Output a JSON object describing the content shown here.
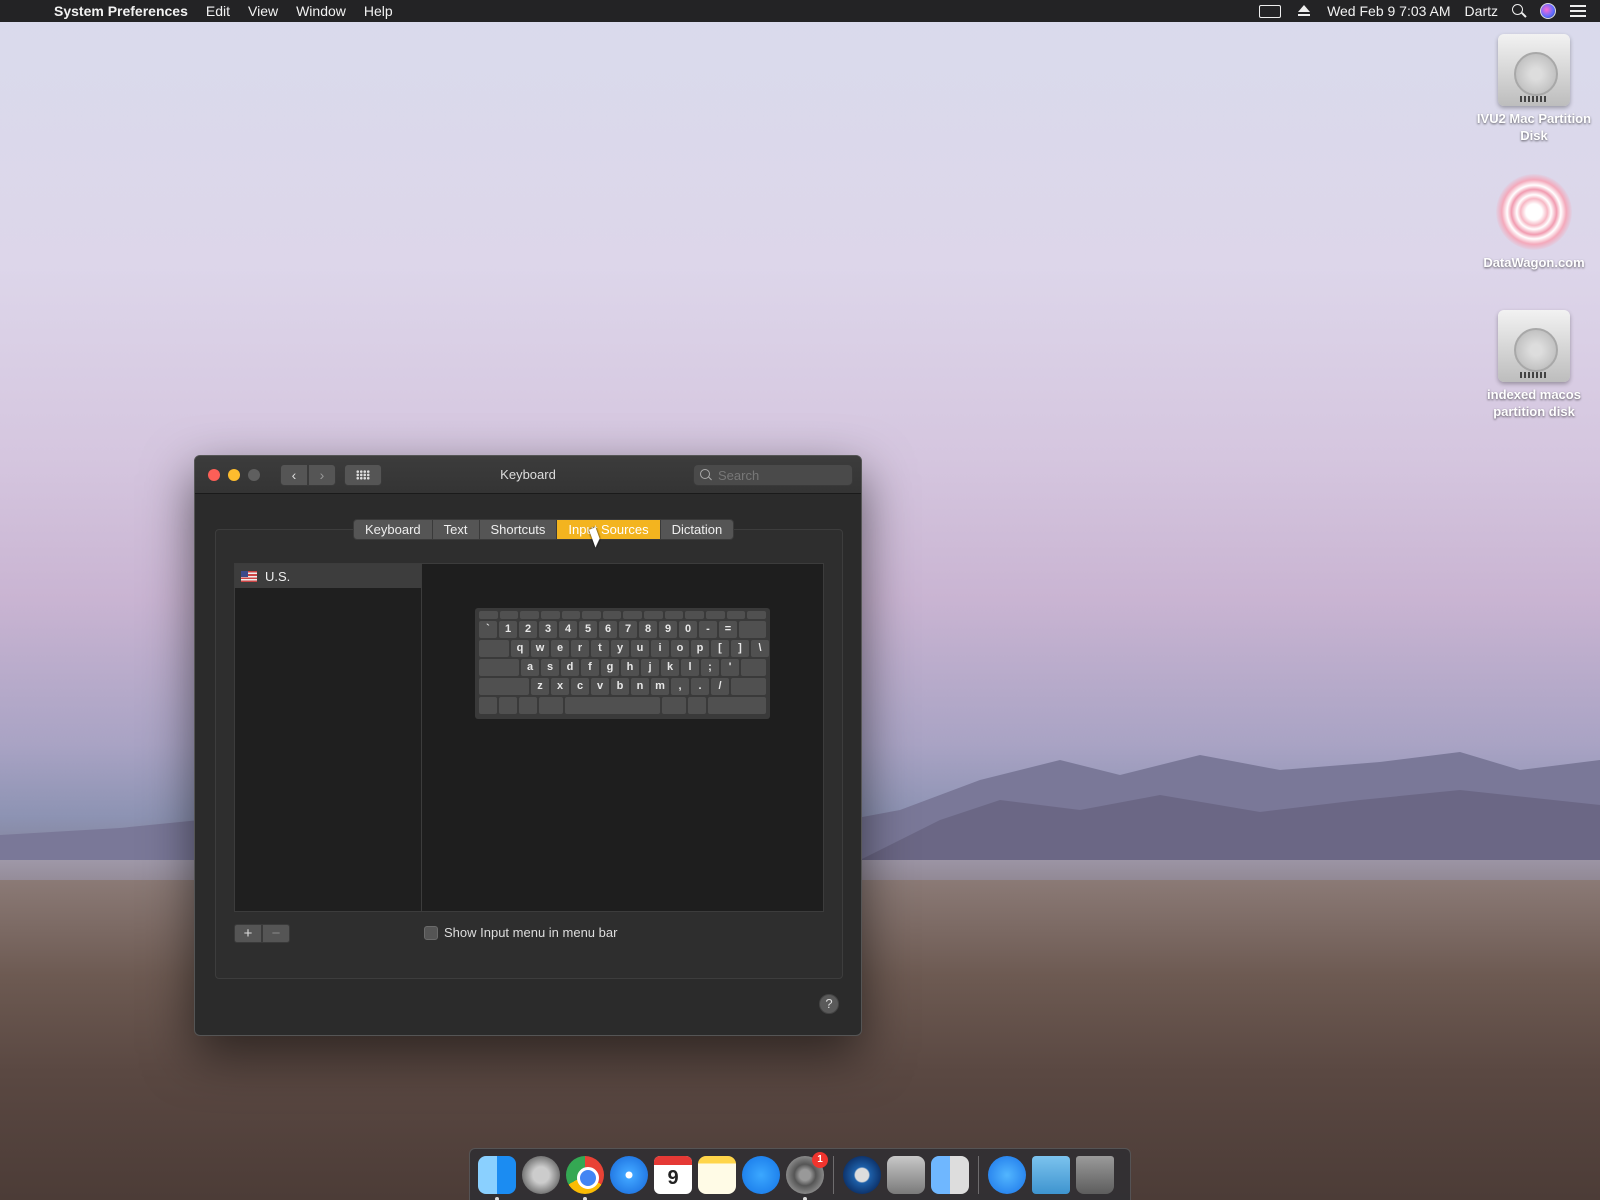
{
  "menubar": {
    "app_name": "System Preferences",
    "menus": [
      "Edit",
      "View",
      "Window",
      "Help"
    ],
    "clock": "Wed Feb 9  7:03 AM",
    "user": "Dartz"
  },
  "desktop_icons": [
    {
      "label": "IVU2 Mac Partition Disk"
    },
    {
      "label": "DataWagon.com"
    },
    {
      "label": "indexed macos partition disk"
    }
  ],
  "window": {
    "title": "Keyboard",
    "search_placeholder": "Search",
    "tabs": [
      {
        "label": "Keyboard",
        "active": false
      },
      {
        "label": "Text",
        "active": false
      },
      {
        "label": "Shortcuts",
        "active": false
      },
      {
        "label": "Input Sources",
        "active": true
      },
      {
        "label": "Dictation",
        "active": false
      }
    ],
    "input_sources": [
      {
        "label": "U.S.",
        "selected": true
      }
    ],
    "keyboard_rows": [
      [
        "`",
        "1",
        "2",
        "3",
        "4",
        "5",
        "6",
        "7",
        "8",
        "9",
        "0",
        "-",
        "="
      ],
      [
        "q",
        "w",
        "e",
        "r",
        "t",
        "y",
        "u",
        "i",
        "o",
        "p",
        "[",
        "]",
        "\\"
      ],
      [
        "a",
        "s",
        "d",
        "f",
        "g",
        "h",
        "j",
        "k",
        "l",
        ";",
        "'"
      ],
      [
        "z",
        "x",
        "c",
        "v",
        "b",
        "n",
        "m",
        ",",
        ".",
        "/"
      ]
    ],
    "add_label": "+",
    "remove_label": "−",
    "show_input_menu_label": "Show Input menu in menu bar",
    "show_input_menu_checked": false,
    "help_label": "?"
  },
  "dock": {
    "calendar_day": "9",
    "calendar_month": "FEB",
    "sysprefs_badge": "1"
  },
  "colors": {
    "tab_active": "#f3b41f",
    "close": "#fc5f57",
    "minimize": "#fdbc2e"
  }
}
